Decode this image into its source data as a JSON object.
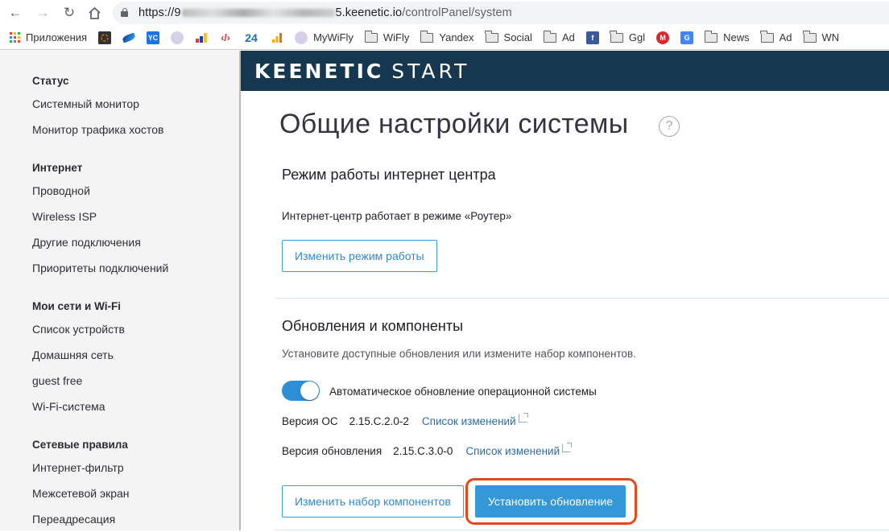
{
  "browser": {
    "url_prefix": "https://9",
    "url_host_suffix": "5.keenetic.io",
    "url_path": "/controlPanel/system"
  },
  "bookmarks": [
    {
      "label": "Приложения",
      "icon": "apps-grid-icon"
    },
    {
      "label": "",
      "icon": "dark-square-icon"
    },
    {
      "label": "",
      "icon": "blue-swoosh-icon"
    },
    {
      "label": "",
      "icon": "yc-icon",
      "text": "YC"
    },
    {
      "label": "",
      "icon": "round-logo-icon"
    },
    {
      "label": "",
      "icon": "bar-chart-icon"
    },
    {
      "label": "",
      "icon": "code-tool-icon"
    },
    {
      "label": "",
      "icon": "number-24-icon",
      "text": "24"
    },
    {
      "label": "",
      "icon": "analytics-icon"
    },
    {
      "label": "MyWiFly",
      "icon": "round-logo-icon"
    },
    {
      "label": "WiFly",
      "icon": "folder-icon"
    },
    {
      "label": "Yandex",
      "icon": "folder-icon"
    },
    {
      "label": "Social",
      "icon": "folder-icon"
    },
    {
      "label": "Ad",
      "icon": "folder-icon"
    },
    {
      "label": "",
      "icon": "facebook-icon",
      "text": "f"
    },
    {
      "label": "Ggl",
      "icon": "folder-icon"
    },
    {
      "label": "",
      "icon": "mega-icon",
      "text": "M"
    },
    {
      "label": "",
      "icon": "google-translate-icon",
      "text": "G"
    },
    {
      "label": "News",
      "icon": "folder-icon"
    },
    {
      "label": "Ad",
      "icon": "folder-icon"
    },
    {
      "label": "WN",
      "icon": "folder-icon"
    }
  ],
  "sidebar": {
    "groups": [
      {
        "title": "Статус",
        "items": [
          "Системный монитор",
          "Монитор трафика хостов"
        ]
      },
      {
        "title": "Интернет",
        "items": [
          "Проводной",
          "Wireless ISP",
          "Другие подключения",
          "Приоритеты подключений"
        ]
      },
      {
        "title": "Мои сети и Wi-Fi",
        "items": [
          "Список устройств",
          "Домашняя сеть",
          "guest free",
          "Wi-Fi-система"
        ]
      },
      {
        "title": "Сетевые правила",
        "items": [
          "Интернет-фильтр",
          "Межсетевой экран",
          "Переадресация"
        ]
      }
    ]
  },
  "header": {
    "logo_bold": "KEENETIC",
    "logo_light": "START",
    "color": "#15374f"
  },
  "page": {
    "title": "Общие настройки системы",
    "help": "?"
  },
  "mode_section": {
    "title": "Режим работы интернет центра",
    "status": "Интернет-центр работает в режиме «Роутер»",
    "change_button": "Изменить режим работы"
  },
  "updates_section": {
    "title": "Обновления и компоненты",
    "description": "Установите доступные обновления или измените набор компонентов.",
    "auto_update_label": "Автоматическое обновление операционной системы",
    "auto_update_enabled": true,
    "os_version_label": "Версия ОС",
    "os_version": "2.15.C.2.0-2",
    "update_version_label": "Версия обновления",
    "update_version": "2.15.C.3.0-0",
    "changelog_link": "Список изменений",
    "change_components_button": "Изменить набор компонентов",
    "install_update_button": "Установить обновление"
  },
  "colors": {
    "accent": "#3497d8",
    "highlight": "#e24a1b",
    "link": "#2e6b9e"
  }
}
